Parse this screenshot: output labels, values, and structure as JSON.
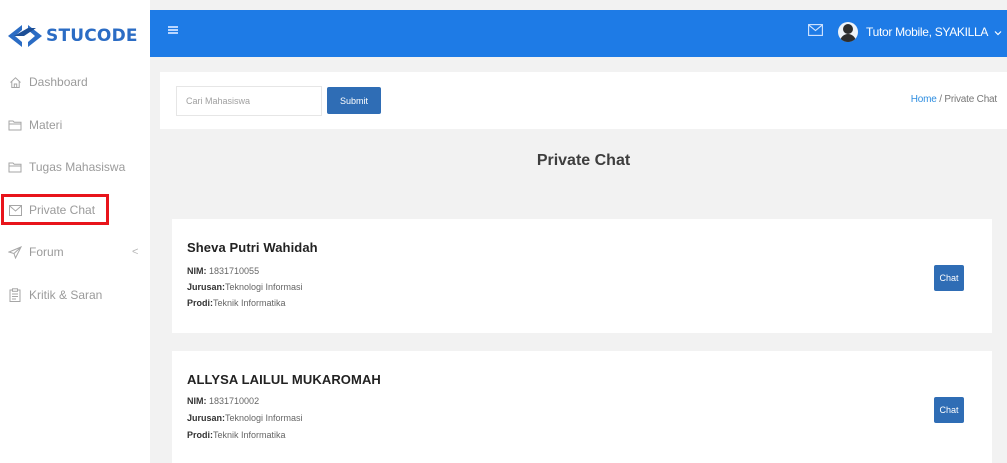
{
  "brand": {
    "name": "STUCODE",
    "color": "#2b6cc4"
  },
  "sidebar": {
    "items": [
      {
        "label": "Dashboard",
        "icon": "home-icon"
      },
      {
        "label": "Materi",
        "icon": "folder-icon"
      },
      {
        "label": "Tugas Mahasiswa",
        "icon": "folder-icon"
      },
      {
        "label": "Private Chat",
        "icon": "mail-icon",
        "highlighted": true
      },
      {
        "label": "Forum",
        "icon": "send-icon",
        "chevron": "<"
      },
      {
        "label": "Kritik & Saran",
        "icon": "clipboard-icon"
      }
    ]
  },
  "topbar": {
    "background": "#1e7be6",
    "menu_icon": "hamburger-icon",
    "mail_icon": "mail-icon",
    "user_label": "Tutor Mobile, SYAKILLA",
    "dropdown_icon": "chevron-down-icon"
  },
  "search": {
    "placeholder": "Cari Mahasiswa",
    "submit_label": "Submit"
  },
  "breadcrumb": {
    "home": "Home",
    "separator": " / ",
    "current": "Private Chat"
  },
  "page_title": "Private Chat",
  "students": [
    {
      "name": "Sheva Putri Wahidah",
      "nim_label": "NIM:",
      "nim": "1831710055",
      "jurusan_label": "Jurusan:",
      "jurusan": "Teknologi Informasi",
      "prodi_label": "Prodi:",
      "prodi": "Teknik Informatika",
      "button": "Chat"
    },
    {
      "name": "ALLYSA LAILUL MUKAROMAH",
      "nim_label": "NIM:",
      "nim": "1831710002",
      "jurusan_label": "Jurusan:",
      "jurusan": "Teknologi Informasi",
      "prodi_label": "Prodi:",
      "prodi": "Teknik Informatika",
      "button": "Chat"
    }
  ],
  "colors": {
    "accent": "#2f6db5",
    "highlight_border": "#e8141b"
  }
}
